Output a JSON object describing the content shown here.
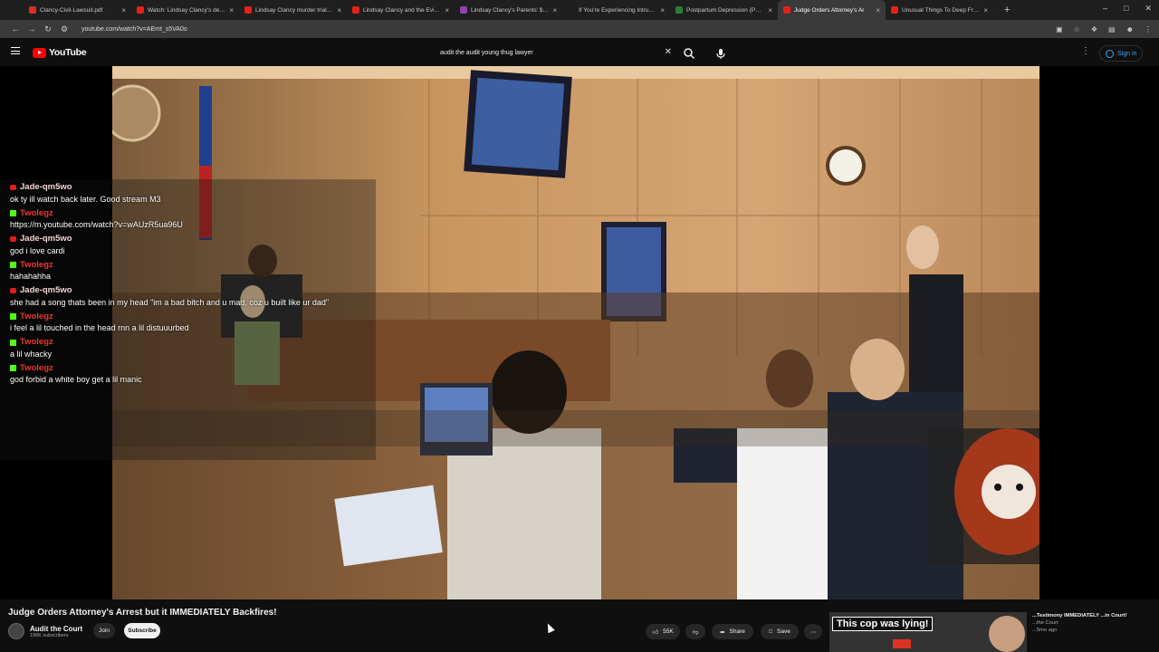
{
  "browser": {
    "tabs": [
      {
        "label": "Clancy-Civil-Lawsuit.pdf",
        "color": "#d93025"
      },
      {
        "label": "Watch: Lindsay Clancy's defens",
        "color": "#e62117"
      },
      {
        "label": "Lindsay Clancy murder trial: Pr",
        "color": "#e62117"
      },
      {
        "label": "Lindsay Clancy and the Evidenc",
        "color": "#e62117"
      },
      {
        "label": "Lindsay Clancy's Parents' $1 Mi",
        "color": "#8e44ad"
      },
      {
        "label": "If You're Experiencing Intrusive",
        "color": "#1f1f1f"
      },
      {
        "label": "Postpartum Depression (PPD):",
        "color": "#2e7d32"
      },
      {
        "label": "Judge Orders Attorney's Ar",
        "color": "#e62117"
      },
      {
        "label": "Unusual Things To Deep Fry - Y",
        "color": "#e62117"
      }
    ],
    "active_tab": 7,
    "url": "youtube.com/watch?v=AEmt_s5VA0o"
  },
  "youtube": {
    "logo_text": "YouTube",
    "search_value": "audit the audit young thug lawyer",
    "signin_label": "Sign in"
  },
  "chat": {
    "messages": [
      {
        "user": "Jade-qm5wo",
        "platform": "youtube",
        "text": "ok ty ill watch back later. Good stream M3"
      },
      {
        "user": "Twolegz",
        "platform": "kick",
        "text": "https://m.youtube.com/watch?v=wAUzR5ua96U"
      },
      {
        "user": "Jade-qm5wo",
        "platform": "youtube",
        "text": "god i love cardi"
      },
      {
        "user": "Twolegz",
        "platform": "kick",
        "text": "hahahahha"
      },
      {
        "user": "Jade-qm5wo",
        "platform": "youtube",
        "text": "she had a song thats been in my head \"im a bad bitch and u mad, coz u built like ur dad\""
      },
      {
        "user": "Twolegz",
        "platform": "kick",
        "text": "i feel a lil touched in the head rnn a lil distuuurbed"
      },
      {
        "user": "Twolegz",
        "platform": "kick",
        "text": "a lil whacky"
      },
      {
        "user": "Twolegz",
        "platform": "kick",
        "text": "god forbid a white boy get a lil manic"
      }
    ]
  },
  "video": {
    "title": "Judge Orders Attorney's Arrest but it IMMEDIATELY Backfires!",
    "channel_name": "Audit the Court",
    "subscribers": "196K subscribers",
    "join_label": "Join",
    "subscribe_label": "Subscribe",
    "likes": "55K",
    "share_label": "Share",
    "save_label": "Save"
  },
  "recommendation": {
    "banner_text": "This cop was lying!",
    "title_partial": "...Testimony IMMEDIATELY ...in Court!",
    "channel": "...the Court",
    "meta": "...5mo ago"
  }
}
